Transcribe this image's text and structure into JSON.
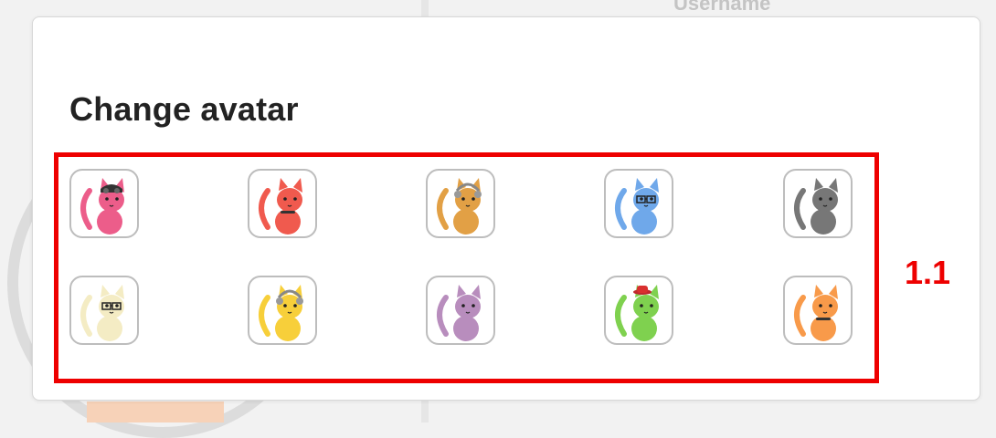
{
  "background": {
    "username_label": "Username"
  },
  "modal": {
    "title": "Change avatar"
  },
  "annotation": {
    "label": "1.1",
    "color": "#ee0000"
  },
  "avatars": [
    {
      "name": "pink-cat-with-goggles-avatar",
      "body": "#ec5d8a",
      "accessory": "goggles"
    },
    {
      "name": "red-cat-avatar",
      "body": "#f05a4e",
      "accessory": "collar"
    },
    {
      "name": "orange-spotted-cat-with-headphones-avatar",
      "body": "#e2a045",
      "accessory": "headphones"
    },
    {
      "name": "blue-cat-with-glasses-avatar",
      "body": "#6fa8ea",
      "accessory": "glasses"
    },
    {
      "name": "gray-cat-avatar",
      "body": "#777777",
      "accessory": "none"
    },
    {
      "name": "cream-cat-with-glasses-avatar",
      "body": "#f4ecc4",
      "accessory": "glasses"
    },
    {
      "name": "yellow-cat-with-headphones-avatar",
      "body": "#f7cf3a",
      "accessory": "headphones"
    },
    {
      "name": "purple-cat-avatar",
      "body": "#b88dbd",
      "accessory": "none"
    },
    {
      "name": "green-cat-with-hat-avatar",
      "body": "#7fd14f",
      "accessory": "hat"
    },
    {
      "name": "orange-cat-avatar",
      "body": "#f89a4a",
      "accessory": "collar"
    }
  ]
}
